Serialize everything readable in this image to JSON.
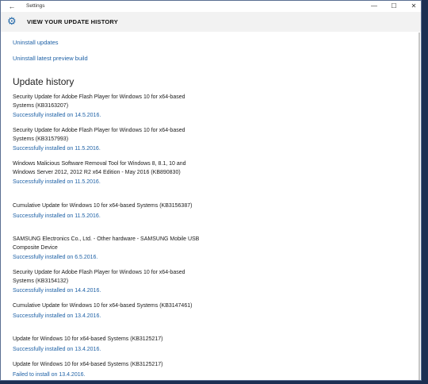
{
  "window": {
    "title": "Settings",
    "back_icon": "back-arrow-icon",
    "controls": {
      "minimize": "—",
      "maximize": "☐",
      "close": "✕"
    }
  },
  "header": {
    "icon": "gear-icon",
    "title": "VIEW YOUR UPDATE HISTORY"
  },
  "links": {
    "uninstall_updates": "Uninstall updates",
    "uninstall_preview": "Uninstall latest preview build"
  },
  "section_title": "Update history",
  "updates": [
    {
      "name": "Security Update for Adobe Flash Player for Windows 10 for x64-based Systems (KB3163207)",
      "status": "Successfully installed on 14.5.2016."
    },
    {
      "name": "Security Update for Adobe Flash Player for Windows 10 for x64-based Systems (KB3157993)",
      "status": "Successfully installed on 11.5.2016."
    },
    {
      "name": "Windows Malicious Software Removal Tool for Windows 8, 8.1, 10 and Windows Server 2012, 2012 R2 x64 Edition - May 2016 (KB890830)",
      "status": "Successfully installed on 11.5.2016."
    },
    {
      "name": "Cumulative Update for Windows 10 for x64-based Systems (KB3156387)",
      "status": "Successfully installed on 11.5.2016."
    },
    {
      "name": "SAMSUNG Electronics Co., Ltd. - Other hardware - SAMSUNG Mobile USB Composite Device",
      "status": "Successfully installed on 6.5.2016."
    },
    {
      "name": "Security Update for Adobe Flash Player for Windows 10 for x64-based Systems (KB3154132)",
      "status": "Successfully installed on 14.4.2016."
    },
    {
      "name": "Cumulative Update for Windows 10 for x64-based Systems (KB3147461)",
      "status": "Successfully installed on 13.4.2016."
    },
    {
      "name": "Update for Windows 10 for x64-based Systems (KB3125217)",
      "status": "Successfully installed on 13.4.2016."
    },
    {
      "name": "Update for Windows 10 for x64-based Systems (KB3125217)",
      "status": "Failed to install on 13.4.2016."
    }
  ]
}
